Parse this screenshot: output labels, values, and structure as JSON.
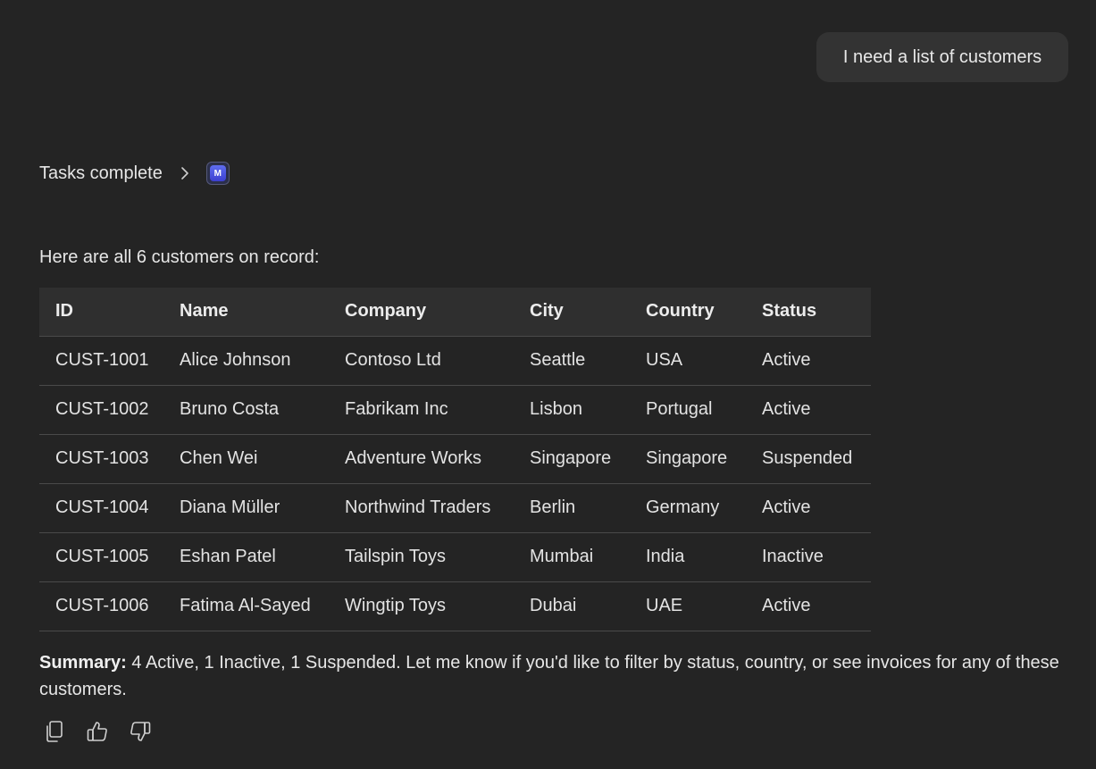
{
  "user_message": {
    "text": "I need a list of customers"
  },
  "status": {
    "label": "Tasks complete",
    "app_badge_letter": "M"
  },
  "response": {
    "intro": "Here are all 6 customers on record:",
    "table": {
      "headers": [
        "ID",
        "Name",
        "Company",
        "City",
        "Country",
        "Status"
      ],
      "rows": [
        [
          "CUST-1001",
          "Alice Johnson",
          "Contoso Ltd",
          "Seattle",
          "USA",
          "Active"
        ],
        [
          "CUST-1002",
          "Bruno Costa",
          "Fabrikam Inc",
          "Lisbon",
          "Portugal",
          "Active"
        ],
        [
          "CUST-1003",
          "Chen Wei",
          "Adventure Works",
          "Singapore",
          "Singapore",
          "Suspended"
        ],
        [
          "CUST-1004",
          "Diana Müller",
          "Northwind Traders",
          "Berlin",
          "Germany",
          "Active"
        ],
        [
          "CUST-1005",
          "Eshan Patel",
          "Tailspin Toys",
          "Mumbai",
          "India",
          "Inactive"
        ],
        [
          "CUST-1006",
          "Fatima Al-Sayed",
          "Wingtip Toys",
          "Dubai",
          "UAE",
          "Active"
        ]
      ]
    },
    "summary_label": "Summary:",
    "summary_text": " 4 Active, 1 Inactive, 1 Suspended. Let me know if you'd like to filter by status, country, or see invoices for any of these customers."
  },
  "actions": [
    {
      "name": "copy-icon"
    },
    {
      "name": "thumbs-up-icon"
    },
    {
      "name": "thumbs-down-icon"
    }
  ],
  "colors": {
    "background": "#242424",
    "bubble": "#333333",
    "table_header": "#2f2f2f",
    "divider": "#4a4a4a",
    "badge_accent": "#4f56e0"
  }
}
